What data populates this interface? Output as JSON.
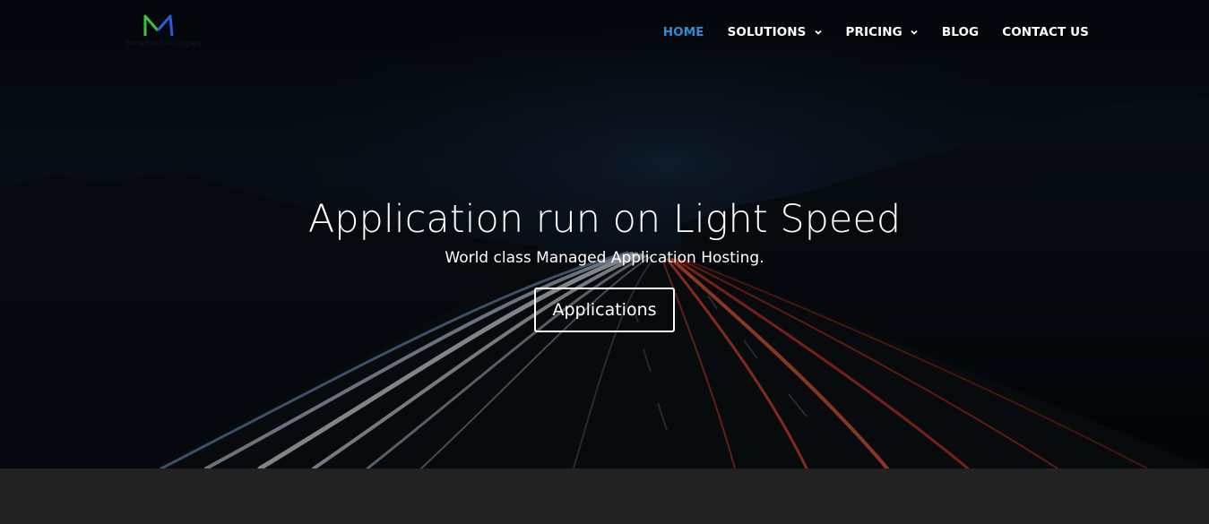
{
  "header": {
    "logo": {
      "icon": "m-logo-icon",
      "text": "Smaltechnologies",
      "colors": {
        "left": "#3bc43b",
        "right": "#2a5bd8"
      }
    },
    "nav": [
      {
        "label": "HOME",
        "active": true,
        "dropdown": false
      },
      {
        "label": "SOLUTIONS",
        "active": false,
        "dropdown": true
      },
      {
        "label": "PRICING",
        "active": false,
        "dropdown": true
      },
      {
        "label": "BLOG",
        "active": false,
        "dropdown": false
      },
      {
        "label": "CONTACT US",
        "active": false,
        "dropdown": false
      }
    ],
    "active_color": "#2e8bd6"
  },
  "hero": {
    "title": "Application run on Light Speed",
    "subtitle": "World class Managed Application Hosting.",
    "button_label": "Applications",
    "background": "night-highway-light-trails"
  }
}
